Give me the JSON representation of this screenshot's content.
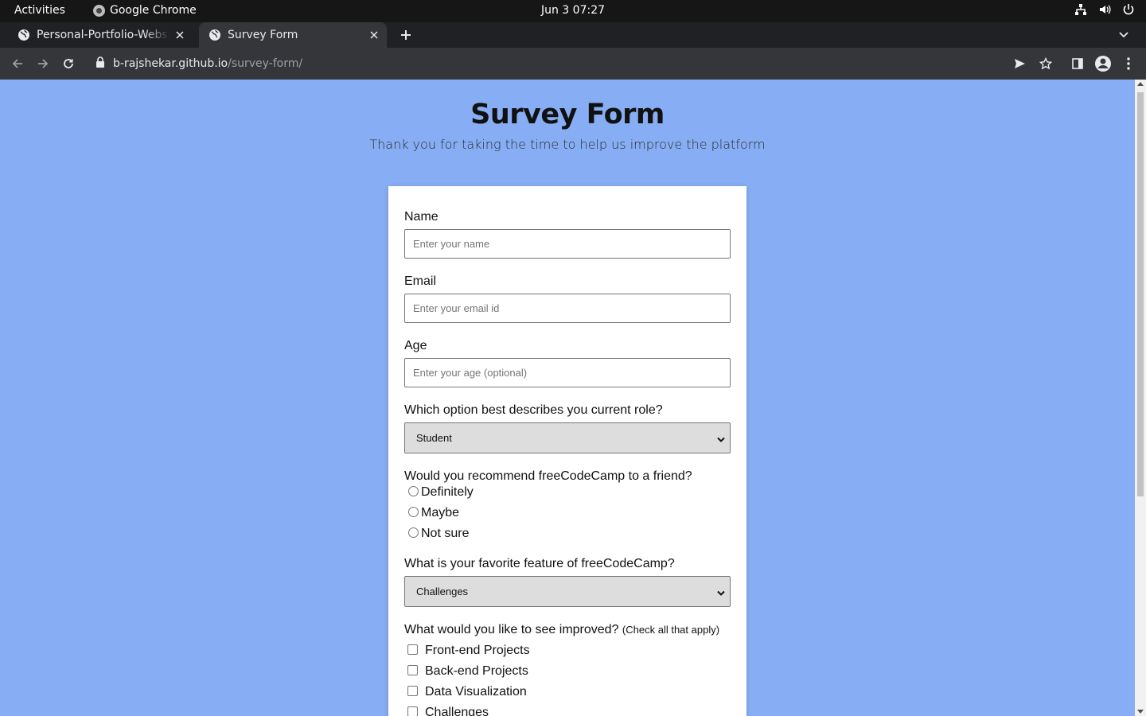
{
  "system": {
    "activities": "Activities",
    "app_name": "Google Chrome",
    "clock": "Jun 3  07:27"
  },
  "browser": {
    "tabs": [
      {
        "title": "Personal-Portfolio-Website",
        "active": false
      },
      {
        "title": "Survey Form",
        "active": true
      }
    ],
    "url_host": "b-rajshekar.github.io",
    "url_path": "/survey-form/"
  },
  "page": {
    "background_color": "#87aef4",
    "title": "Survey Form",
    "description": "Thank you for taking the time to help us improve the platform",
    "form": {
      "name_label": "Name",
      "name_placeholder": "Enter your name",
      "email_label": "Email",
      "email_placeholder": "Enter your email id",
      "age_label": "Age",
      "age_placeholder": "Enter your age (optional)",
      "role_label": "Which option best describes you current role?",
      "role_selected": "Student",
      "recommend_label": "Would you recommend freeCodeCamp to a friend?",
      "recommend_options": [
        "Definitely",
        "Maybe",
        "Not sure"
      ],
      "feature_label": "What is your favorite feature of freeCodeCamp?",
      "feature_selected": "Challenges",
      "improve_label": "What would you like to see improved?",
      "improve_hint": "(Check all that apply)",
      "improve_options": [
        "Front-end Projects",
        "Back-end Projects",
        "Data Visualization",
        "Challenges"
      ]
    }
  }
}
